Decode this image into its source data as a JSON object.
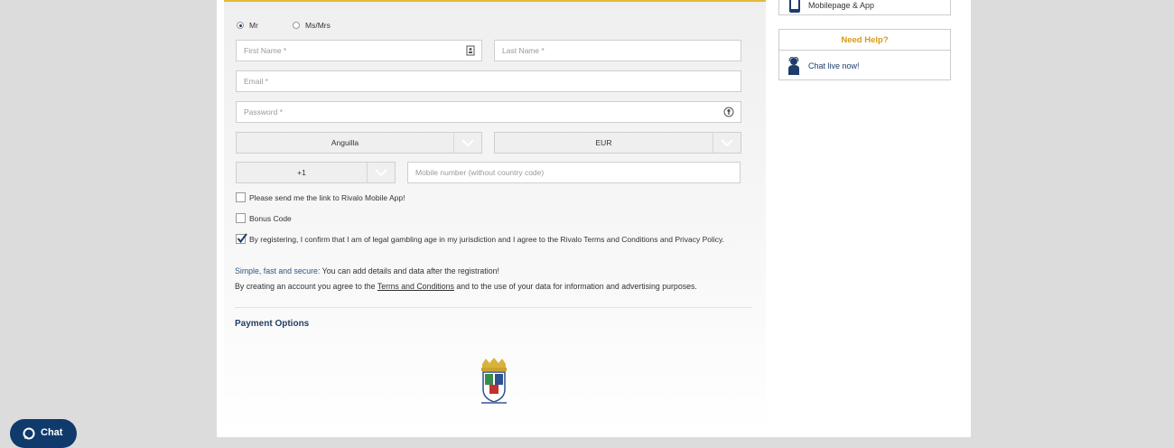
{
  "form": {
    "salutation": {
      "mr": "Mr",
      "msmrs": "Ms/Mrs",
      "selected": "Mr"
    },
    "first_name_placeholder": "First Name *",
    "last_name_placeholder": "Last Name *",
    "email_placeholder": "Email *",
    "password_placeholder": "Password *",
    "country_value": "Anguilla",
    "currency_value": "EUR",
    "phone_code_value": "+1",
    "mobile_placeholder": "Mobile number (without country code)",
    "checkboxes": [
      {
        "label": "Please send me the link to Rivalo Mobile App!",
        "checked": false
      },
      {
        "label": "Bonus Code",
        "checked": false
      },
      {
        "label": "By registering, I confirm that I am of legal gambling age in my jurisdiction and I agree to the Rivalo Terms and Conditions and Privacy Policy.",
        "checked": true
      }
    ],
    "info_highlight": "Simple, fast and secure:",
    "info_text": " You can add details and data after the registration!",
    "agree_prefix": "By creating an account you agree to the ",
    "agree_link": "Terms and Conditions",
    "agree_suffix": " and to the use of your data for information and advertising purposes.",
    "payment_title": "Payment Options"
  },
  "sidebar": {
    "mobile_label": "Mobilepage & App",
    "help_title": "Need Help?",
    "chat_link": "Chat live now!"
  },
  "chat_widget": {
    "label": "Chat"
  },
  "colors": {
    "accent_gold": "#d99a17",
    "brand_blue": "#1f3d6b",
    "topline": "#e2b93b"
  }
}
